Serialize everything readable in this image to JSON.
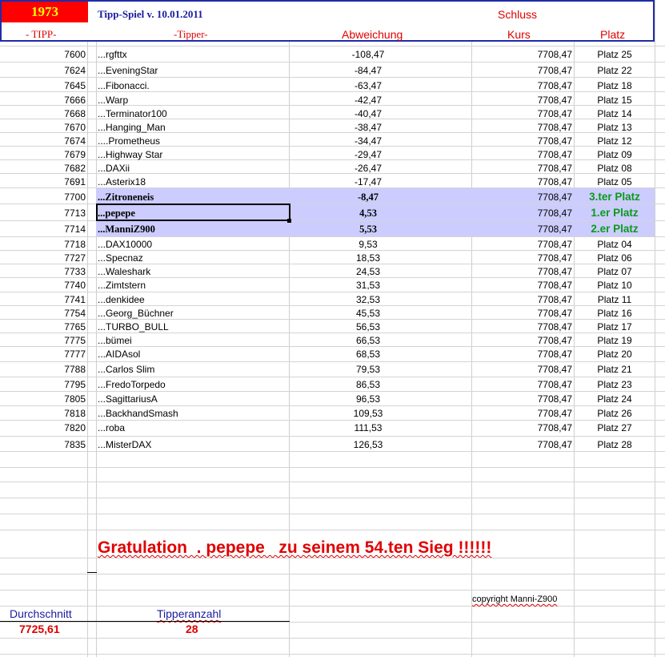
{
  "header": {
    "year": "1973",
    "title": "Tipp-Spiel v. 10.01.2011",
    "schluss": "Schluss",
    "col_tipp": "- TIPP-",
    "col_tipper": "-Tipper-",
    "col_abweichung": "Abweichung",
    "col_kurs": "Kurs",
    "col_platz": "Platz"
  },
  "rows": [
    {
      "tipp": "7600",
      "name": "...rgfttx",
      "abw": "-108,47",
      "kurs": "7708,47",
      "platz": "Platz 25"
    },
    {
      "tipp": "7624",
      "name": "...EveningStar",
      "abw": "-84,47",
      "kurs": "7708,47",
      "platz": "Platz 22"
    },
    {
      "tipp": "7645",
      "name": "...Fibonacci.",
      "abw": "-63,47",
      "kurs": "7708,47",
      "platz": "Platz 18"
    },
    {
      "tipp": "7666",
      "name": "...Warp",
      "abw": "-42,47",
      "kurs": "7708,47",
      "platz": "Platz 15"
    },
    {
      "tipp": "7668",
      "name": "...Terminator100",
      "abw": "-40,47",
      "kurs": "7708,47",
      "platz": "Platz 14"
    },
    {
      "tipp": "7670",
      "name": "...Hanging_Man",
      "abw": "-38,47",
      "kurs": "7708,47",
      "platz": "Platz 13"
    },
    {
      "tipp": "7674",
      "name": "....Prometheus",
      "abw": "-34,47",
      "kurs": "7708,47",
      "platz": "Platz 12"
    },
    {
      "tipp": "7679",
      "name": "...Highway Star",
      "abw": "-29,47",
      "kurs": "7708,47",
      "platz": "Platz 09"
    },
    {
      "tipp": "7682",
      "name": "...DAXii",
      "abw": "-26,47",
      "kurs": "7708,47",
      "platz": "Platz 08"
    },
    {
      "tipp": "7691",
      "name": "...Asterix18",
      "abw": "-17,47",
      "kurs": "7708,47",
      "platz": "Platz 05"
    },
    {
      "tipp": "7700",
      "name": "...Zitroneneis",
      "abw": "-8,47",
      "kurs": "7708,47",
      "platz": "3.ter Platz",
      "hl": true
    },
    {
      "tipp": "7713",
      "name": "...pepepe",
      "abw": "4,53",
      "kurs": "7708,47",
      "platz": "1.er Platz",
      "hl": true
    },
    {
      "tipp": "7714",
      "name": "...ManniZ900",
      "abw": "5,53",
      "kurs": "7708,47",
      "platz": "2.er Platz",
      "hl": true
    },
    {
      "tipp": "7718",
      "name": "...DAX10000",
      "abw": "9,53",
      "kurs": "7708,47",
      "platz": "Platz 04"
    },
    {
      "tipp": "7727",
      "name": "...Specnaz",
      "abw": "18,53",
      "kurs": "7708,47",
      "platz": "Platz 06"
    },
    {
      "tipp": "7733",
      "name": "...Waleshark",
      "abw": "24,53",
      "kurs": "7708,47",
      "platz": "Platz 07"
    },
    {
      "tipp": "7740",
      "name": "...Zimtstern",
      "abw": "31,53",
      "kurs": "7708,47",
      "platz": "Platz 10"
    },
    {
      "tipp": "7741",
      "name": "...denkidee",
      "abw": "32,53",
      "kurs": "7708,47",
      "platz": "Platz 11"
    },
    {
      "tipp": "7754",
      "name": "...Georg_Büchner",
      "abw": "45,53",
      "kurs": "7708,47",
      "platz": "Platz 16"
    },
    {
      "tipp": "7765",
      "name": "...TURBO_BULL",
      "abw": "56,53",
      "kurs": "7708,47",
      "platz": "Platz 17"
    },
    {
      "tipp": "7775",
      "name": "...bümei",
      "abw": "66,53",
      "kurs": "7708,47",
      "platz": "Platz 19"
    },
    {
      "tipp": "7777",
      "name": "...AIDAsol",
      "abw": "68,53",
      "kurs": "7708,47",
      "platz": "Platz 20"
    },
    {
      "tipp": "7788",
      "name": "...Carlos Slim",
      "abw": "79,53",
      "kurs": "7708,47",
      "platz": "Platz 21"
    },
    {
      "tipp": "7795",
      "name": "...FredoTorpedo",
      "abw": "86,53",
      "kurs": "7708,47",
      "platz": "Platz 23"
    },
    {
      "tipp": "7805",
      "name": "...SagittariusA",
      "abw": "96,53",
      "kurs": "7708,47",
      "platz": "Platz 24"
    },
    {
      "tipp": "7818",
      "name": "...BackhandSmash",
      "abw": "109,53",
      "kurs": "7708,47",
      "platz": "Platz 26"
    },
    {
      "tipp": "7820",
      "name": "...roba",
      "abw": "111,53",
      "kurs": "7708,47",
      "platz": "Platz 27"
    },
    {
      "tipp": "7835",
      "name": "...MisterDAX",
      "abw": "126,53",
      "kurs": "7708,47",
      "platz": "Platz 28"
    }
  ],
  "gratulation": "Gratulation  . pepepe   zu seinem 54.ten Sieg !!!!!!",
  "copyright": "copyright Manni-Z900",
  "summary": {
    "durchschnitt_label": "Durchschnitt",
    "durchschnitt_value": "7725,61",
    "tipperanzahl_label": "Tipperanzahl",
    "tipperanzahl_value": "28"
  },
  "colors": {
    "accent_red": "#e00000",
    "highlight_row": "#ccccff",
    "winner_green": "#0a9a1a",
    "header_border": "#1f2ca8",
    "year_bg": "#ff0000",
    "year_fg": "#ffff00"
  }
}
